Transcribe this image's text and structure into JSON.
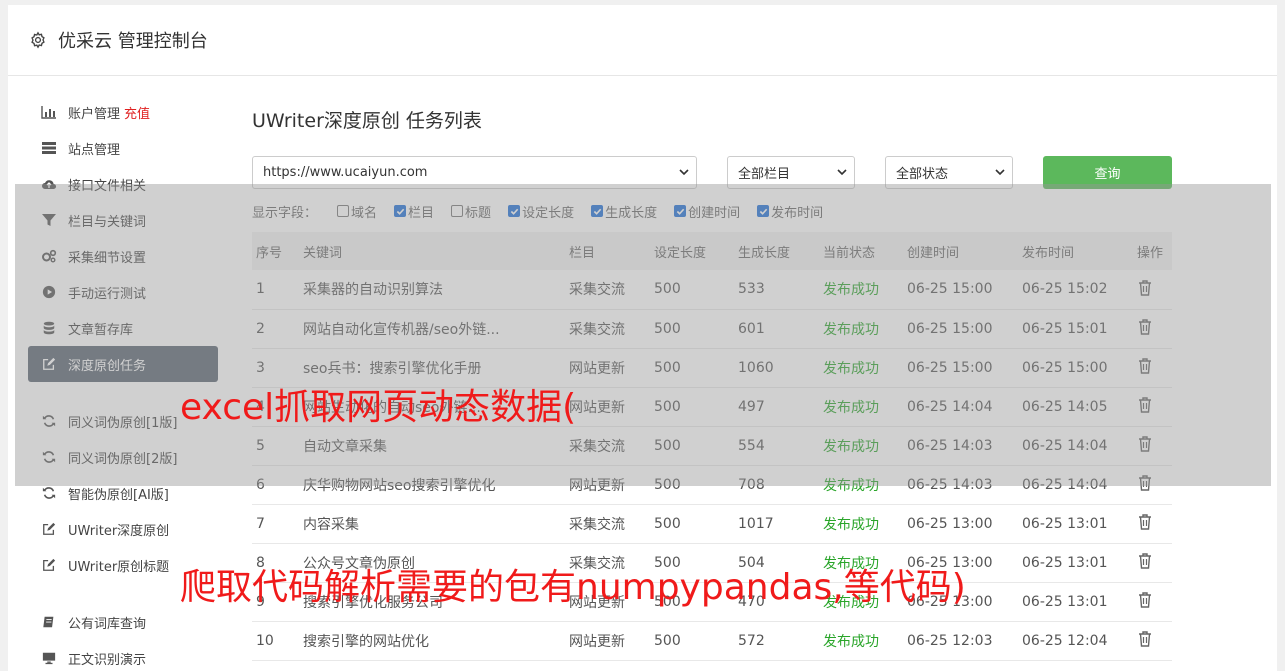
{
  "header": {
    "title": "优采云 管理控制台",
    "icon": "gear-icon"
  },
  "sidebar": {
    "group1": [
      {
        "label": "账户管理",
        "tag": "充值",
        "icon": "bar-chart-icon"
      },
      {
        "label": "站点管理",
        "icon": "server-icon"
      },
      {
        "label": "接口文件相关",
        "icon": "cloud-upload-icon"
      },
      {
        "label": "栏目与关键词",
        "icon": "filter-icon"
      },
      {
        "label": "采集细节设置",
        "icon": "gears-icon"
      },
      {
        "label": "手动运行测试",
        "icon": "play-circle-icon"
      },
      {
        "label": "文章暂存库",
        "icon": "database-icon"
      },
      {
        "label": "深度原创任务",
        "icon": "edit-icon",
        "active": true
      }
    ],
    "group2": [
      {
        "label": "同义词伪原创[1版]",
        "icon": "refresh-icon"
      },
      {
        "label": "同义词伪原创[2版]",
        "icon": "refresh-icon"
      },
      {
        "label": "智能伪原创[AI版]",
        "icon": "refresh-icon"
      },
      {
        "label": "UWriter深度原创",
        "icon": "edit-icon"
      },
      {
        "label": "UWriter原创标题",
        "icon": "edit-icon"
      }
    ],
    "group3": [
      {
        "label": "公有词库查询",
        "icon": "book-icon"
      },
      {
        "label": "正文识别演示",
        "icon": "monitor-icon"
      }
    ]
  },
  "main": {
    "title": "UWriter深度原创 任务列表",
    "site_select": "https://www.ucaiyun.com",
    "column_select": "全部栏目",
    "status_select": "全部状态",
    "query_button": "查询",
    "fields_label": "显示字段：",
    "fields": [
      {
        "label": "域名",
        "checked": false
      },
      {
        "label": "栏目",
        "checked": true
      },
      {
        "label": "标题",
        "checked": false
      },
      {
        "label": "设定长度",
        "checked": true
      },
      {
        "label": "生成长度",
        "checked": true
      },
      {
        "label": "创建时间",
        "checked": true
      },
      {
        "label": "发布时间",
        "checked": true
      }
    ],
    "columns": [
      "序号",
      "关键词",
      "栏目",
      "设定长度",
      "生成长度",
      "当前状态",
      "创建时间",
      "发布时间",
      "操作"
    ],
    "rows": [
      [
        "1",
        "采集器的自动识别算法",
        "采集交流",
        "500",
        "533",
        "发布成功",
        "06-25 15:00",
        "06-25 15:02"
      ],
      [
        "2",
        "网站自动化宣传机器/seo外链...",
        "采集交流",
        "500",
        "601",
        "发布成功",
        "06-25 15:00",
        "06-25 15:01"
      ],
      [
        "3",
        "seo兵书：搜索引擎优化手册",
        "网站更新",
        "500",
        "1060",
        "发布成功",
        "06-25 15:00",
        "06-25 15:00"
      ],
      [
        "4",
        "网站生动化的自动seo外链...",
        "网站更新",
        "500",
        "497",
        "发布成功",
        "06-25 14:04",
        "06-25 14:05"
      ],
      [
        "5",
        "自动文章采集",
        "采集交流",
        "500",
        "554",
        "发布成功",
        "06-25 14:03",
        "06-25 14:04"
      ],
      [
        "6",
        "庆华购物网站seo搜索引擎优化",
        "网站更新",
        "500",
        "708",
        "发布成功",
        "06-25 14:03",
        "06-25 14:04"
      ],
      [
        "7",
        "内容采集",
        "采集交流",
        "500",
        "1017",
        "发布成功",
        "06-25 13:00",
        "06-25 13:01"
      ],
      [
        "8",
        "公众号文章伪原创",
        "采集交流",
        "500",
        "504",
        "发布成功",
        "06-25 13:00",
        "06-25 13:01"
      ],
      [
        "9",
        "搜索引擎优化服务公司",
        "网站更新",
        "500",
        "470",
        "发布成功",
        "06-25 13:00",
        "06-25 13:01"
      ],
      [
        "10",
        "搜索引擎的网站优化",
        "网站更新",
        "500",
        "572",
        "发布成功",
        "06-25 12:03",
        "06-25 12:04"
      ]
    ]
  },
  "watermarks": {
    "line1": "excel抓取网页动态数据(",
    "line2": "爬取代码解析需要的包有numpypandas,等代码)"
  },
  "colors": {
    "status_success": "#2aa52a",
    "query_button": "#5cb85c",
    "active_sidebar": "#5a6472",
    "watermark": "#f01a1a",
    "recharge_tag": "#e02020"
  }
}
